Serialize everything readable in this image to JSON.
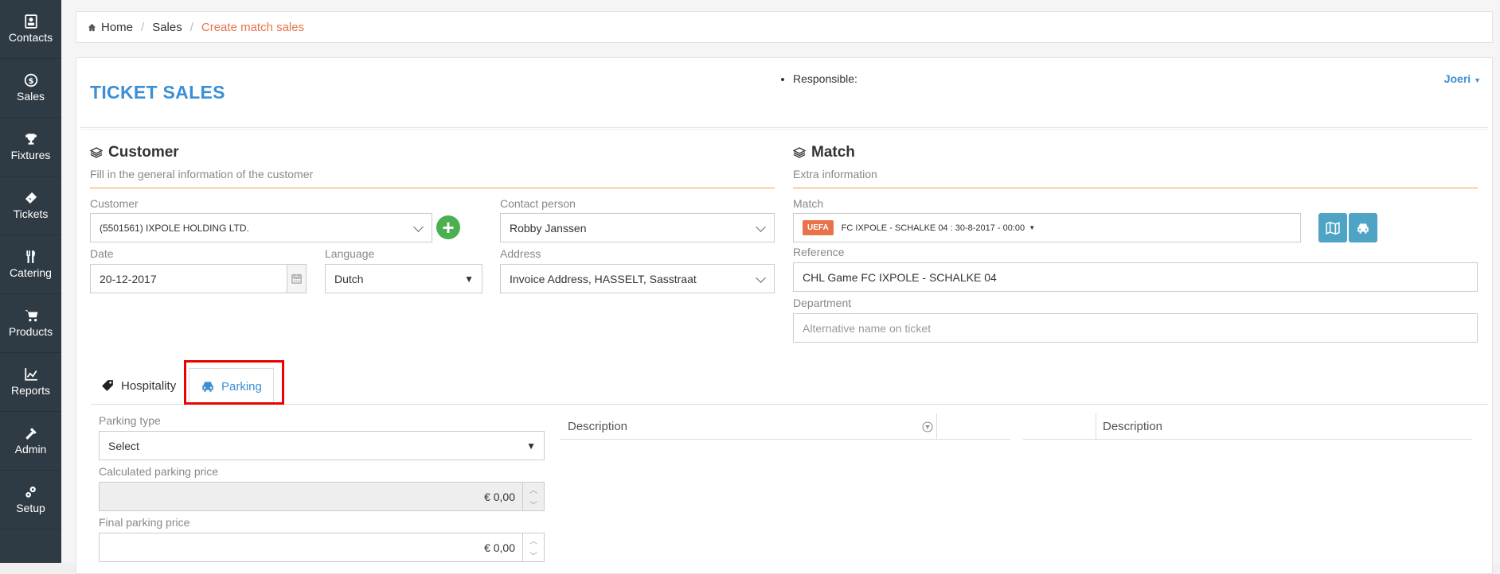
{
  "sidebar": {
    "items": [
      {
        "label": "Contacts",
        "icon": "contacts-icon"
      },
      {
        "label": "Sales",
        "icon": "dollar-icon"
      },
      {
        "label": "Fixtures",
        "icon": "trophy-icon"
      },
      {
        "label": "Tickets",
        "icon": "ticket-icon"
      },
      {
        "label": "Catering",
        "icon": "cutlery-icon"
      },
      {
        "label": "Products",
        "icon": "cart-icon"
      },
      {
        "label": "Reports",
        "icon": "chart-icon"
      },
      {
        "label": "Admin",
        "icon": "tools-icon"
      },
      {
        "label": "Setup",
        "icon": "gears-icon"
      }
    ]
  },
  "breadcrumb": {
    "home": "Home",
    "sales": "Sales",
    "current": "Create match sales"
  },
  "header": {
    "title": "TICKET SALES",
    "responsible_label": "Responsible:",
    "user": "Joeri"
  },
  "customer_section": {
    "title": "Customer",
    "subtitle": "Fill in the general information of the customer",
    "customer_label": "Customer",
    "customer_value": "(5501561) IXPOLE HOLDING LTD.",
    "contact_label": "Contact person",
    "contact_value": "Robby Janssen",
    "date_label": "Date",
    "date_value": "20-12-2017",
    "language_label": "Language",
    "language_value": "Dutch",
    "address_label": "Address",
    "address_value": "Invoice Address, HASSELT, Sasstraat"
  },
  "match_section": {
    "title": "Match",
    "subtitle": "Extra information",
    "match_label": "Match",
    "match_badge": "UEFA",
    "match_value": "FC IXPOLE - SCHALKE 04 : 30-8-2017 - 00:00",
    "reference_label": "Reference",
    "reference_value": "CHL Game FC IXPOLE - SCHALKE 04",
    "department_label": "Department",
    "department_placeholder": "Alternative name on ticket"
  },
  "tabs": [
    {
      "label": "Hospitality",
      "icon": "tag-icon"
    },
    {
      "label": "Parking",
      "icon": "car-icon",
      "active": true
    }
  ],
  "parking": {
    "type_label": "Parking type",
    "type_value": "Select",
    "calc_label": "Calculated parking price",
    "calc_value": "€ 0,00",
    "final_label": "Final parking price",
    "final_value": "€ 0,00"
  },
  "grid1": {
    "col1": "Description"
  },
  "grid2": {
    "col1": "Description"
  },
  "colors": {
    "sidebar": "#2f3b44",
    "accent": "#3b8fd4",
    "orange": "#e8734a",
    "highlight": "#ee0000"
  }
}
